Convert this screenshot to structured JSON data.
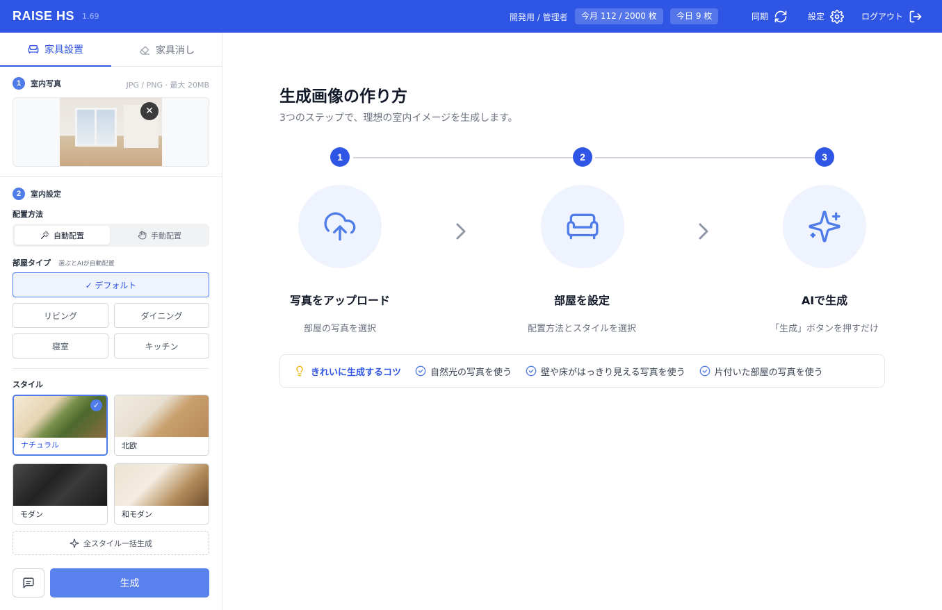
{
  "header": {
    "brand": "RAISE HS",
    "version": "1.69",
    "user": "開発用 / 管理者",
    "month_usage": "今月 112 / 2000 枚",
    "today_usage": "今日 9 枚",
    "sync_label": "同期",
    "settings_label": "設定",
    "logout_label": "ログアウト"
  },
  "sidebar": {
    "tabs": [
      {
        "label": "家具設置",
        "icon": "sofa-icon",
        "active": true
      },
      {
        "label": "家具消し",
        "icon": "eraser-icon",
        "active": false
      }
    ],
    "section1": {
      "num": "1",
      "title": "室内写真",
      "hint": "JPG / PNG · 最大 20MB"
    },
    "section2": {
      "num": "2",
      "title": "室内設定"
    },
    "method": {
      "label": "配置方法",
      "options": [
        {
          "label": "自動配置",
          "icon": "magic-wand-icon",
          "selected": true
        },
        {
          "label": "手動配置",
          "icon": "hand-pointer-icon",
          "selected": false
        }
      ]
    },
    "room": {
      "label": "部屋タイプ",
      "hint": "選ぶとAIが自動配置",
      "selected": "✓ デフォルト",
      "options": [
        "リビング",
        "ダイニング",
        "寝室",
        "キッチン"
      ]
    },
    "style": {
      "label": "スタイル",
      "cards": [
        {
          "name": "ナチュラル",
          "selected": true
        },
        {
          "name": "北欧",
          "selected": false
        },
        {
          "name": "モダン",
          "selected": false
        },
        {
          "name": "和モダン",
          "selected": false
        }
      ],
      "bulk_label": "全スタイル一括生成"
    },
    "generate_label": "生成"
  },
  "main": {
    "title": "生成画像の作り方",
    "lead": "3つのステップで、理想の室内イメージを生成します。",
    "steps": [
      {
        "num": "1",
        "title": "写真をアップロード",
        "desc": "部屋の写真を選択",
        "icon": "cloud-upload-icon"
      },
      {
        "num": "2",
        "title": "部屋を設定",
        "desc": "配置方法とスタイルを選択",
        "icon": "sofa-icon"
      },
      {
        "num": "3",
        "title": "AIで生成",
        "desc": "「生成」ボタンを押すだけ",
        "icon": "sparkles-icon"
      }
    ],
    "tips": {
      "head": "きれいに生成するコツ",
      "items": [
        "自然光の写真を使う",
        "壁や床がはっきり見える写真を使う",
        "片付いた部屋の写真を使う"
      ]
    }
  },
  "colors": {
    "primary": "#2f55e4",
    "accent": "#4f7ce8",
    "button": "#5a82ee",
    "soft": "#eef3fd"
  }
}
